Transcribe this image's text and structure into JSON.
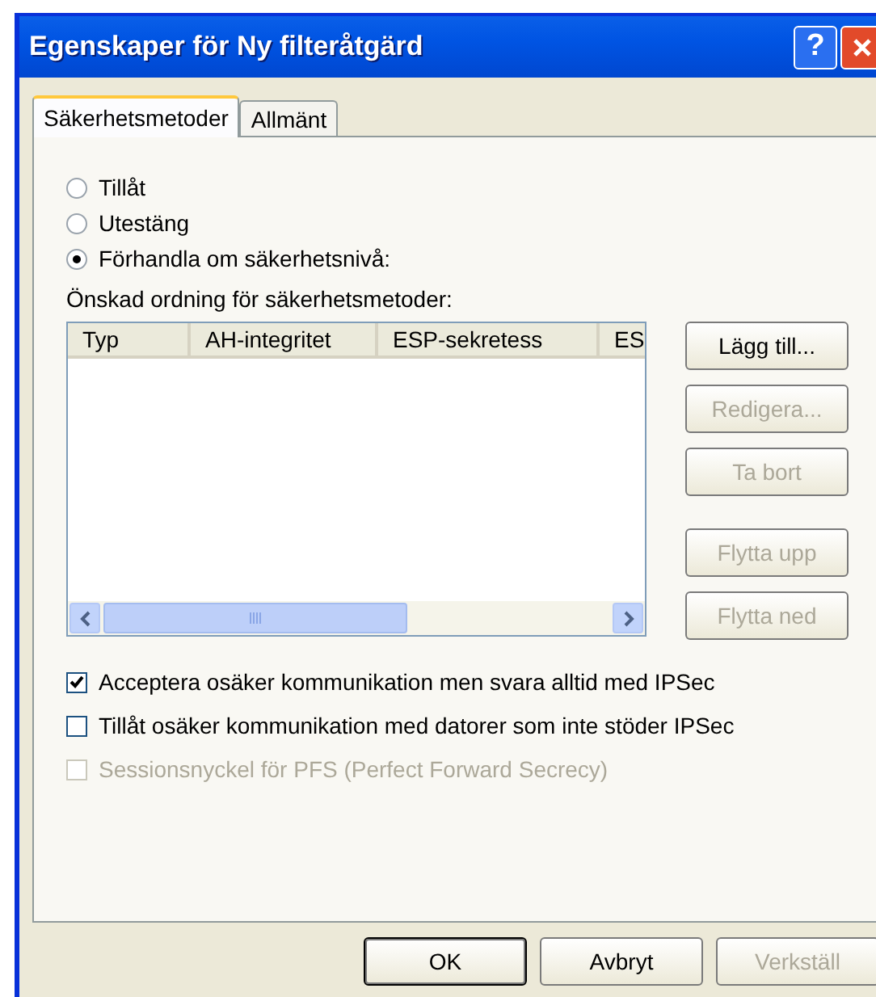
{
  "window": {
    "title": "Egenskaper för Ny filteråtgärd"
  },
  "title_buttons": [
    {
      "kind": "help",
      "label": "?"
    },
    {
      "kind": "close"
    }
  ],
  "tabs": [
    {
      "label": "Säkerhetsmetoder",
      "selected": true
    },
    {
      "label": "Allmänt",
      "selected": false
    }
  ],
  "radios": [
    {
      "label": "Tillåt",
      "selected": false
    },
    {
      "label": "Utestäng",
      "selected": false
    },
    {
      "label": "Förhandla om säkerhetsnivå:",
      "selected": true
    }
  ],
  "list_label": "Önskad ordning för säkerhetsmetoder:",
  "table": {
    "columns": [
      "Typ",
      "AH-integritet",
      "ESP-sekretess",
      "ES"
    ]
  },
  "side_button_groups": [
    [
      {
        "label": "Lägg till...",
        "disabled": false
      },
      {
        "label": "Redigera...",
        "disabled": true
      },
      {
        "label": "Ta bort",
        "disabled": true
      }
    ],
    [
      {
        "label": "Flytta upp",
        "disabled": true
      },
      {
        "label": "Flytta ned",
        "disabled": true
      }
    ]
  ],
  "checkboxes": [
    {
      "label": "Acceptera osäker kommunikation men svara alltid med IPSec",
      "checked": true,
      "disabled": false
    },
    {
      "label": "Tillåt osäker kommunikation med datorer som inte stöder IPSec",
      "checked": false,
      "disabled": false
    },
    {
      "label": "Sessionsnyckel för PFS (Perfect Forward Secrecy)",
      "checked": false,
      "disabled": true
    }
  ],
  "buttons": [
    {
      "label": "OK",
      "disabled": false,
      "default": true
    },
    {
      "label": "Avbryt",
      "disabled": false,
      "default": false
    },
    {
      "label": "Verkställ",
      "disabled": true,
      "default": false
    }
  ]
}
